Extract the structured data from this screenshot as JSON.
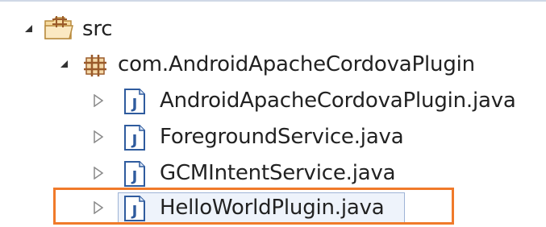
{
  "tree": {
    "items": [
      {
        "label": "src",
        "icon": "package-folder-icon",
        "expander": "expanded"
      },
      {
        "label": "com.AndroidApacheCordovaPlugin",
        "icon": "package-icon",
        "expander": "expanded"
      },
      {
        "label": "AndroidApacheCordovaPlugin.java",
        "icon": "java-file-icon",
        "expander": "collapsed"
      },
      {
        "label": "ForegroundService.java",
        "icon": "java-file-icon",
        "expander": "collapsed"
      },
      {
        "label": "GCMIntentService.java",
        "icon": "java-file-icon",
        "expander": "collapsed"
      },
      {
        "label": "HelloWorldPlugin.java",
        "icon": "java-file-icon",
        "expander": "collapsed",
        "selected": true
      }
    ]
  },
  "colors": {
    "highlight": "#f07a2a",
    "java_icon_blue": "#2f5b9e",
    "package_brown": "#9a5a2a"
  }
}
